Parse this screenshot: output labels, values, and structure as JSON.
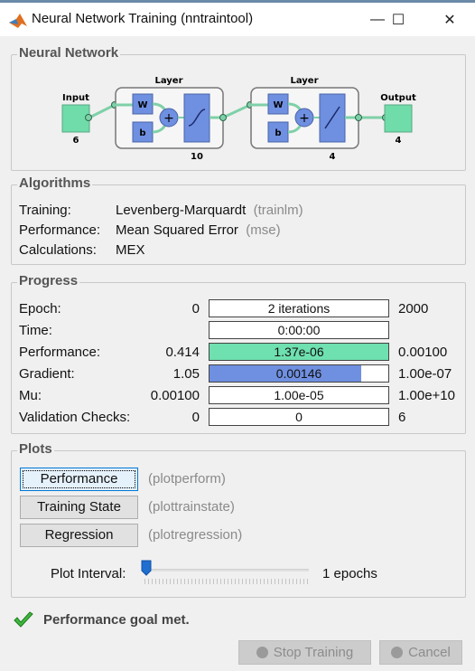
{
  "window": {
    "title": "Neural Network Training (nntraintool)",
    "app_icon": "matlab-logo-icon",
    "controls": {
      "minimize": "—",
      "maximize": "☐",
      "close": "✕"
    }
  },
  "neural_network": {
    "section_title": "Neural Network",
    "input": {
      "label": "Input",
      "size": "6"
    },
    "layers": [
      {
        "label": "Layer",
        "weight": "W",
        "bias": "b",
        "transfer": "tansig",
        "size": "10"
      },
      {
        "label": "Layer",
        "weight": "W",
        "bias": "b",
        "transfer": "purelin",
        "size": "4"
      }
    ],
    "output": {
      "label": "Output",
      "size": "4"
    },
    "colors": {
      "io_box": "#6fdcaa",
      "layer_block": "#6f8fe0",
      "connector": "#7fd0a8"
    }
  },
  "algorithms": {
    "section_title": "Algorithms",
    "rows": [
      {
        "label": "Training:",
        "value": "Levenberg-Marquardt",
        "fn": "(trainlm)"
      },
      {
        "label": "Performance:",
        "value": "Mean Squared Error",
        "fn": "(mse)"
      },
      {
        "label": "Calculations:",
        "value": "MEX",
        "fn": ""
      }
    ]
  },
  "progress": {
    "section_title": "Progress",
    "rows": [
      {
        "label": "Epoch:",
        "start": "0",
        "current": "2 iterations",
        "end": "2000",
        "fill_fraction": 0,
        "fill_color": ""
      },
      {
        "label": "Time:",
        "start": "",
        "current": "0:00:00",
        "end": "",
        "fill_fraction": 0,
        "fill_color": ""
      },
      {
        "label": "Performance:",
        "start": "0.414",
        "current": "1.37e-06",
        "end": "0.00100",
        "fill_fraction": 1.0,
        "fill_color": "#6fe0b0"
      },
      {
        "label": "Gradient:",
        "start": "1.05",
        "current": "0.00146",
        "end": "1.00e-07",
        "fill_fraction": 0.85,
        "fill_color": "#6f8fe0"
      },
      {
        "label": "Mu:",
        "start": "0.00100",
        "current": "1.00e-05",
        "end": "1.00e+10",
        "fill_fraction": 0,
        "fill_color": ""
      },
      {
        "label": "Validation Checks:",
        "start": "0",
        "current": "0",
        "end": "6",
        "fill_fraction": 0,
        "fill_color": ""
      }
    ]
  },
  "plots": {
    "section_title": "Plots",
    "buttons": [
      {
        "label": "Performance",
        "fn": "(plotperform)"
      },
      {
        "label": "Training State",
        "fn": "(plottrainstate)"
      },
      {
        "label": "Regression",
        "fn": "(plotregression)"
      }
    ],
    "interval_label": "Plot Interval:",
    "interval_value": "1 epochs",
    "interval_slider_fraction": 0
  },
  "status": {
    "icon": "checkmark-icon",
    "message": "Performance goal met."
  },
  "footer": {
    "stop_label": "Stop Training",
    "cancel_label": "Cancel"
  }
}
